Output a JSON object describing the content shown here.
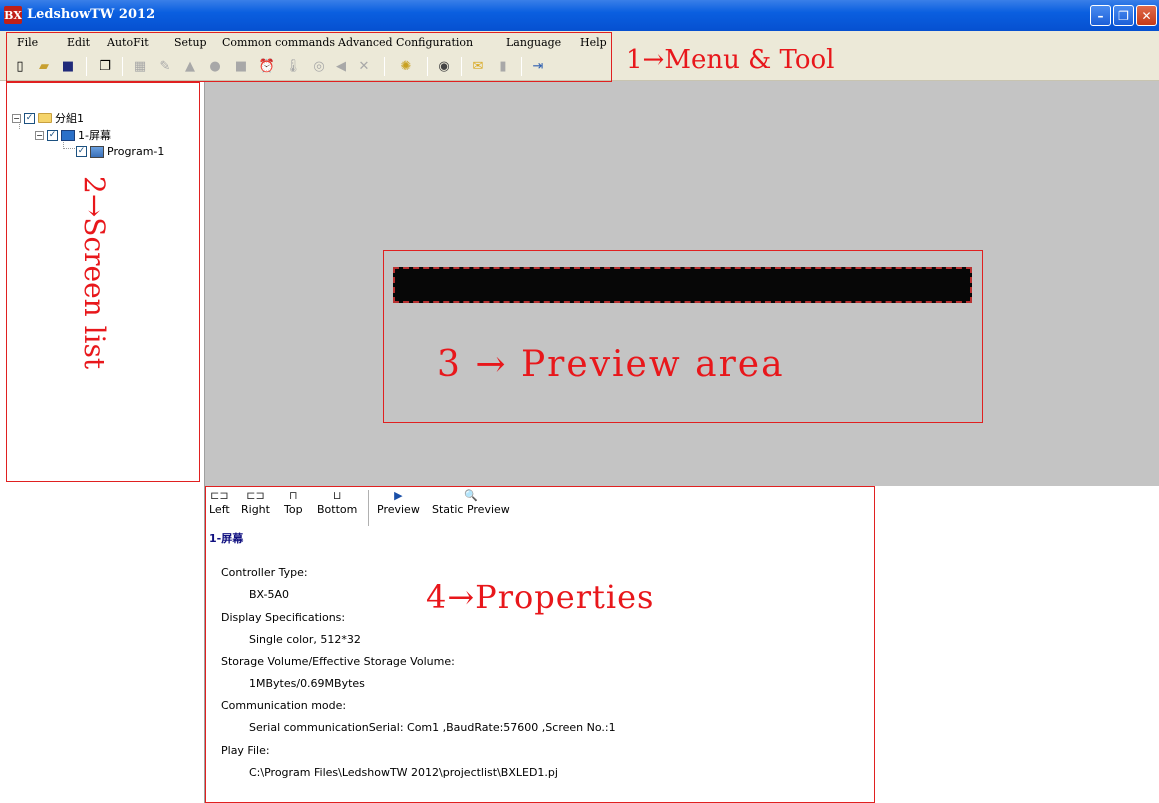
{
  "window": {
    "logo_text": "BX",
    "title": "LedshowTW 2012",
    "minimize": "–",
    "restore": "❐",
    "close": "✕"
  },
  "menu": [
    "File",
    "Edit",
    "AutoFit",
    "Setup",
    "Common commands",
    "Advanced Configuration",
    "Language",
    "Help"
  ],
  "toolbar_icons": [
    "new-icon",
    "open-folder-icon",
    "save-icon",
    "window-icon",
    "grid-icon",
    "edit-icon",
    "brightness-icon",
    "circle-icon",
    "square-icon",
    "alarm-icon",
    "thermometer-icon",
    "counter-icon",
    "speaker-icon",
    "delete-icon",
    "bulb-icon",
    "clock-icon",
    "message-icon",
    "usb-icon",
    "exit-icon"
  ],
  "annotations": {
    "menu_tool": "1→Menu & Tool",
    "screen_list": "2→Screen list",
    "preview_area": "3 → Preview area",
    "properties": "4→Properties"
  },
  "tree": {
    "group": "分組1",
    "screen": "1-屏幕",
    "program": "Program-1"
  },
  "properties_toolbar": {
    "left": "Left",
    "right": "Right",
    "top": "Top",
    "bottom": "Bottom",
    "preview": "Preview",
    "static_preview": "Static Preview"
  },
  "properties": {
    "screen_name": "1-屏幕",
    "controller_type_label": "Controller Type:",
    "controller_type": "BX-5A0",
    "display_spec_label": "Display Specifications:",
    "display_spec": "Single color, 512*32",
    "storage_label": "Storage Volume/Effective Storage Volume:",
    "storage": "1MBytes/0.69MBytes",
    "comm_label": "Communication mode:",
    "comm": "Serial communicationSerial: Com1 ,BaudRate:57600 ,Screen No.:1",
    "play_file_label": "Play File:",
    "play_file": "C:\\Program Files\\LedshowTW 2012\\projectlist\\BXLED1.pj"
  },
  "colors": {
    "titlebar": "#0a5fe0",
    "chrome": "#ece9d8",
    "preview_bg": "#c4c4c4",
    "annotation": "#e8171b",
    "screen_title": "#101080"
  }
}
